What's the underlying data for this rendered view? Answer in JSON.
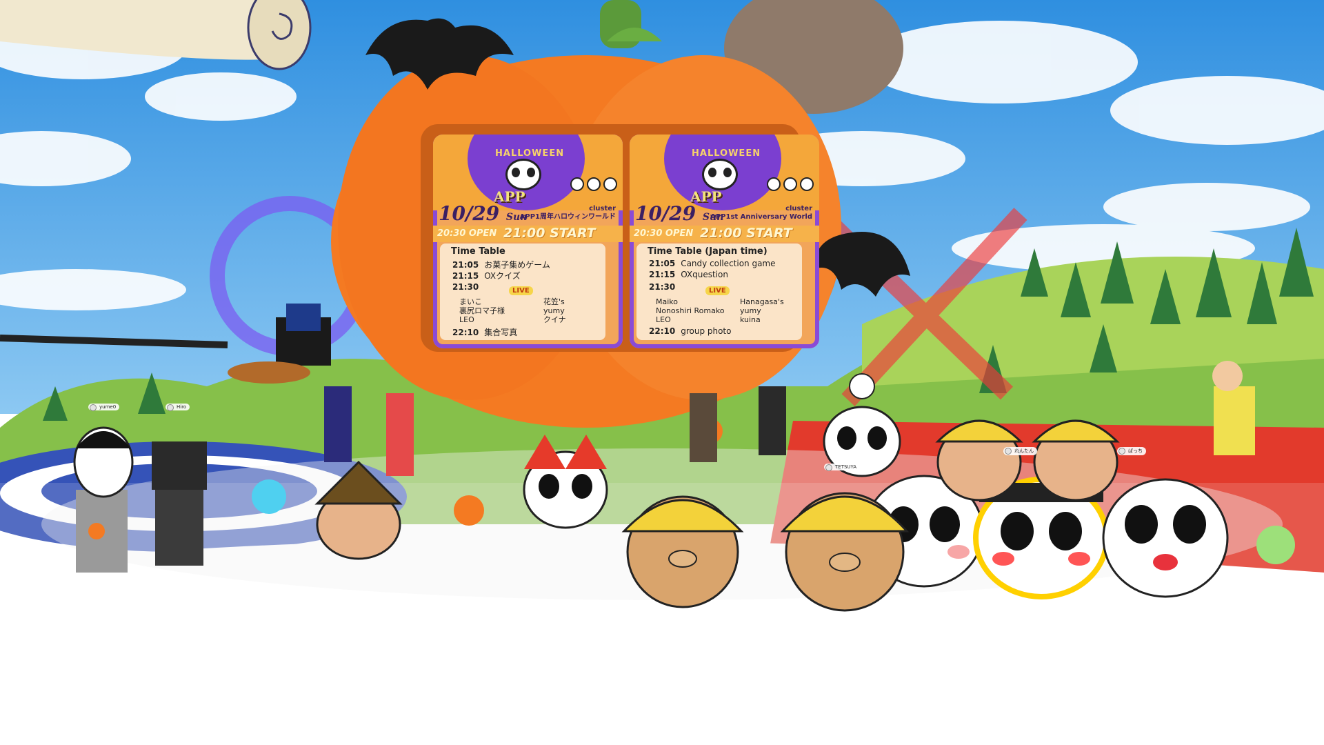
{
  "scene": {
    "colors": {
      "sky": "#3fa0e8",
      "pumpkin": "#f47a22",
      "grass": "#8cc63f",
      "stage_red": "#e23a2c",
      "stage_blue": "#3553b8"
    },
    "icons": [
      "bat-icon",
      "pumpkin-icon",
      "panda-avatar",
      "halloween-hat"
    ]
  },
  "posters": [
    {
      "header": "HALLOWEEN",
      "logo": "APP",
      "date": "10/29",
      "day": "Sun",
      "brand": "cluster",
      "world": "APP1周年ハロウィンワールド",
      "open": "20:30 OPEN",
      "start": "21:00 START",
      "timetable_title": "Time Table",
      "items": [
        {
          "time": "21:05",
          "label": "お菓子集めゲーム"
        },
        {
          "time": "21:15",
          "label": "OXクイズ"
        },
        {
          "time": "21:30",
          "label": ""
        },
        {
          "time": "22:10",
          "label": "集合写真"
        }
      ],
      "live_label": "LIVE",
      "performers_left": [
        "まいこ",
        "裏尻ロマ子様",
        "LEO"
      ],
      "performers_right": [
        "花笠's",
        "yumy",
        "クイナ"
      ]
    },
    {
      "header": "HALLOWEEN",
      "logo": "APP",
      "date": "10/29",
      "day": "Sun",
      "brand": "cluster",
      "world": "APP1st Anniversary World",
      "open": "20:30 OPEN",
      "start": "21:00 START",
      "timetable_title": "Time Table (Japan time)",
      "items": [
        {
          "time": "21:05",
          "label": "Candy collection game"
        },
        {
          "time": "21:15",
          "label": "OXquestion"
        },
        {
          "time": "21:30",
          "label": ""
        },
        {
          "time": "22:10",
          "label": "group photo"
        }
      ],
      "live_label": "LIVE",
      "performers_left": [
        "Maiko",
        "Nonoshiri Romako",
        "LEO"
      ],
      "performers_right": [
        "Hanagasa's",
        "yumy",
        "kuina"
      ]
    }
  ],
  "nametags": [
    "yume0",
    "Hiro",
    "れんたん",
    "ぱっち",
    "TETSUYA"
  ]
}
